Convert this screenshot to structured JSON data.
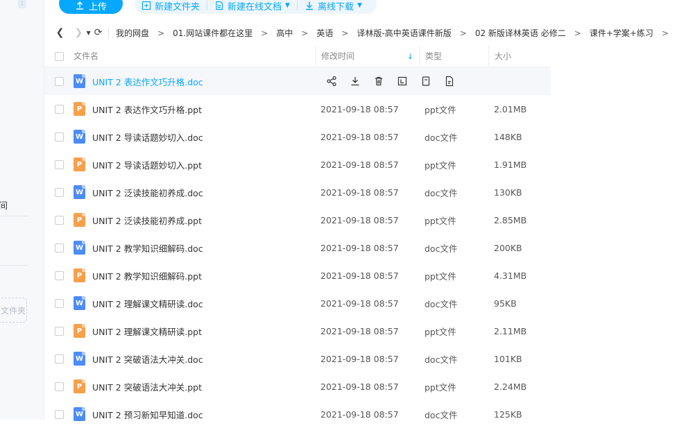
{
  "sidebar": {
    "partial_label_1": "间",
    "partial_folder_label": "文件夹"
  },
  "toolbar": {
    "upload_label": "上传",
    "new_folder_label": "新建文件夹",
    "new_online_doc_label": "新建在线文档",
    "offline_download_label": "离线下载"
  },
  "breadcrumb": {
    "items": [
      "我的网盘",
      "01.网站课件都在这里",
      "高中",
      "英语",
      "译林版-高中英语课件新版",
      "02 新版译林英语 必修二",
      "课件+学案+练习"
    ]
  },
  "table": {
    "headers": {
      "name": "文件名",
      "time": "修改时间",
      "type": "类型",
      "size": "大小"
    },
    "rows": [
      {
        "name": "UNIT 2 表达作文巧升格.doc",
        "time": "",
        "type": "",
        "size": "",
        "icon": "doc"
      },
      {
        "name": "UNIT 2 表达作文巧升格.ppt",
        "time": "2021-09-18 08:57",
        "type": "ppt文件",
        "size": "2.01MB",
        "icon": "ppt"
      },
      {
        "name": "UNIT 2 导读话题妙切入.doc",
        "time": "2021-09-18 08:57",
        "type": "doc文件",
        "size": "148KB",
        "icon": "doc"
      },
      {
        "name": "UNIT 2 导读话题妙切入.ppt",
        "time": "2021-09-18 08:57",
        "type": "ppt文件",
        "size": "1.91MB",
        "icon": "ppt"
      },
      {
        "name": "UNIT 2 泛读技能初养成.doc",
        "time": "2021-09-18 08:57",
        "type": "doc文件",
        "size": "130KB",
        "icon": "doc"
      },
      {
        "name": "UNIT 2 泛读技能初养成.ppt",
        "time": "2021-09-18 08:57",
        "type": "ppt文件",
        "size": "2.85MB",
        "icon": "ppt"
      },
      {
        "name": "UNIT 2 教学知识细解码.doc",
        "time": "2021-09-18 08:57",
        "type": "doc文件",
        "size": "200KB",
        "icon": "doc"
      },
      {
        "name": "UNIT 2 教学知识细解码.ppt",
        "time": "2021-09-18 08:57",
        "type": "ppt文件",
        "size": "4.31MB",
        "icon": "ppt"
      },
      {
        "name": "UNIT 2 理解课文精研读.doc",
        "time": "2021-09-18 08:57",
        "type": "doc文件",
        "size": "95KB",
        "icon": "doc"
      },
      {
        "name": "UNIT 2 理解课文精研读.ppt",
        "time": "2021-09-18 08:57",
        "type": "ppt文件",
        "size": "2.11MB",
        "icon": "ppt"
      },
      {
        "name": "UNIT 2 突破语法大冲关.doc",
        "time": "2021-09-18 08:57",
        "type": "doc文件",
        "size": "101KB",
        "icon": "doc"
      },
      {
        "name": "UNIT 2 突破语法大冲关.ppt",
        "time": "2021-09-18 08:57",
        "type": "ppt文件",
        "size": "2.24MB",
        "icon": "ppt"
      },
      {
        "name": "UNIT 2 预习新知早知道.doc",
        "time": "2021-09-18 08:57",
        "type": "doc文件",
        "size": "125KB",
        "icon": "doc"
      }
    ]
  },
  "colors": {
    "accent": "#06a7ff",
    "doc_icon": "#4e8cf5",
    "ppt_icon": "#f7a04b"
  }
}
